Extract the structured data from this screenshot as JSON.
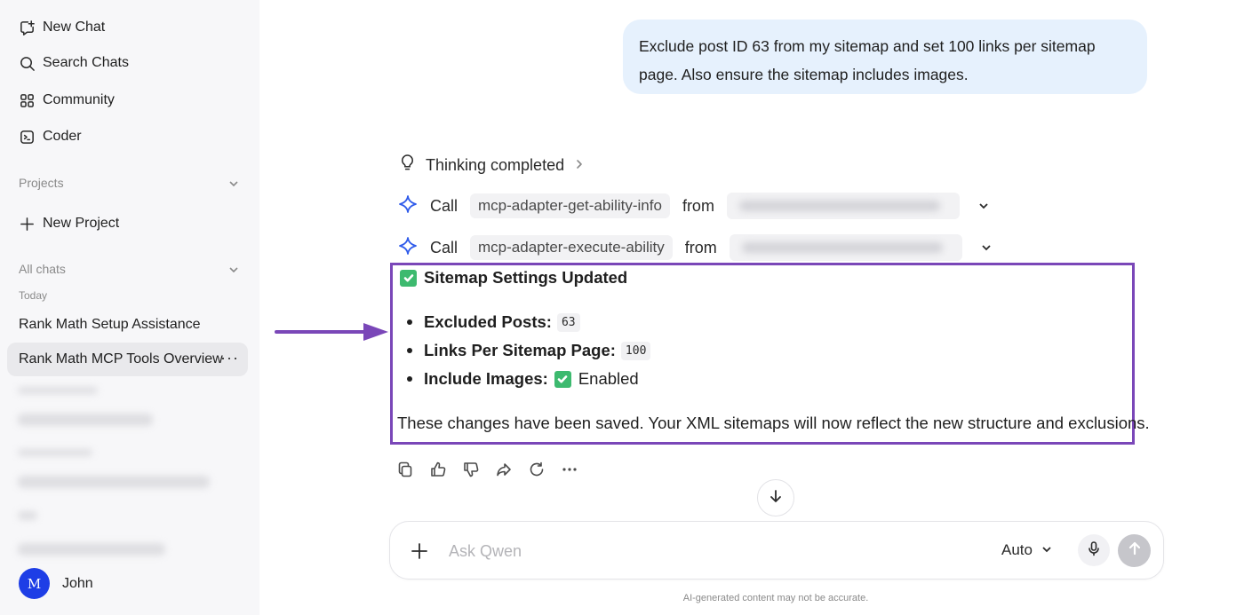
{
  "sidebar": {
    "nav": {
      "new_chat": "New Chat",
      "search_chats": "Search Chats",
      "community": "Community",
      "coder": "Coder"
    },
    "projects_label": "Projects",
    "new_project": "New Project",
    "all_chats_label": "All chats",
    "today_label": "Today",
    "chats": [
      "Rank Math Setup Assistance",
      "Rank Math MCP Tools Overview"
    ],
    "more_icon": "···",
    "user": {
      "initial": "M",
      "name": "John"
    }
  },
  "conversation": {
    "user_message": "Exclude post ID 63 from my sitemap and set 100 links per sitemap page. Also ensure the sitemap includes images.",
    "thinking_status": "Thinking completed",
    "calls": [
      {
        "verb": "Call",
        "tool": "mcp-adapter-get-ability-info",
        "from": "from"
      },
      {
        "verb": "Call",
        "tool": "mcp-adapter-execute-ability",
        "from": "from"
      }
    ],
    "result": {
      "title": "Sitemap Settings Updated",
      "items": [
        {
          "key": "Excluded Posts:",
          "value": "63"
        },
        {
          "key": "Links Per Sitemap Page:",
          "value": "100"
        },
        {
          "key": "Include Images:",
          "value": "Enabled"
        }
      ],
      "summary": "These changes have been saved. Your XML sitemaps will now reflect the new structure and exclusions."
    }
  },
  "composer": {
    "placeholder": "Ask Qwen",
    "mode": "Auto",
    "disclaimer": "AI-generated content may not be accurate."
  },
  "colors": {
    "accent": "#2f5bea",
    "highlight": "#7a47b8",
    "check": "#3dba6f",
    "avatar": "#1e3ee6"
  }
}
